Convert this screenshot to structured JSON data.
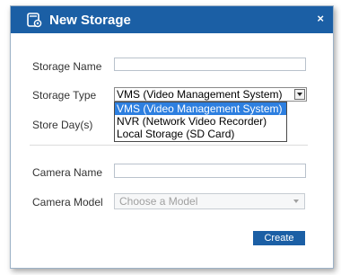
{
  "dialog": {
    "title": "New Storage",
    "close_glyph": "×",
    "icon": "storage-settings-icon"
  },
  "form": {
    "storage_name_label": "Storage Name",
    "storage_name_value": "",
    "storage_type_label": "Storage Type",
    "storage_type_value": "VMS (Video Management System)",
    "storage_type_options": [
      "VMS (Video Management System)",
      "NVR (Network Video Recorder)",
      "Local Storage (SD Card)"
    ],
    "store_days_label": "Store Day(s)",
    "camera_name_label": "Camera Name",
    "camera_name_value": "",
    "camera_model_label": "Camera Model",
    "camera_model_placeholder": "Choose a Model",
    "create_label": "Create"
  },
  "colors": {
    "titlebar": "#1b5fa5",
    "selected_option": "#2d7fe0",
    "button": "#1b5fa5"
  }
}
